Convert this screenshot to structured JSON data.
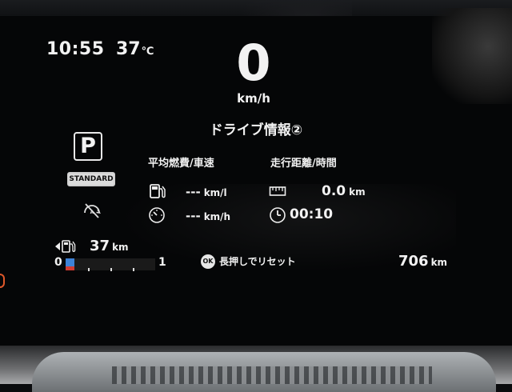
{
  "status": {
    "time": "10:55",
    "temperature": "37",
    "temperature_unit": "℃"
  },
  "speed": {
    "value": "0",
    "unit": "km/h"
  },
  "screen_title": "ドライブ情報②",
  "gear": {
    "position": "P",
    "drive_mode": "STANDARD"
  },
  "stats": {
    "left_header": "平均燃費/車速",
    "right_header": "走行距離/時間",
    "avg_fuel": {
      "value": "---",
      "unit": "km/l",
      "icon": "fuel-pump-icon"
    },
    "avg_speed": {
      "value": "---",
      "unit": "km/h",
      "icon": "speedometer-icon"
    },
    "distance": {
      "value": "0.0",
      "unit": "km",
      "icon": "ruler-icon"
    },
    "time": {
      "value": "00:10",
      "icon": "clock-icon"
    }
  },
  "range": {
    "value": "37",
    "unit": "km",
    "icon": "fuel-range-icon"
  },
  "fuel_gauge": {
    "min_label": "0",
    "max_label": "1",
    "level": 0.1,
    "colors": {
      "fill": "#3e82d6",
      "low": "#d23b30"
    }
  },
  "reset_hint": {
    "button_label": "OK",
    "text": "長押しでリセット"
  },
  "odometer": {
    "value": "706",
    "unit": "km"
  }
}
